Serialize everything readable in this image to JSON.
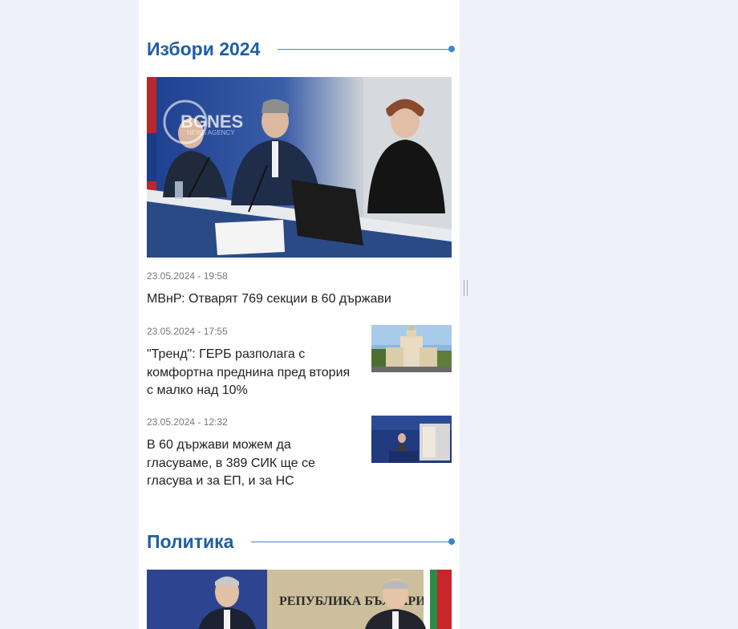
{
  "sections": [
    {
      "title": "Избори 2024",
      "hero_watermark": {
        "brand": "BGNES",
        "sub": "NEWS AGENCY"
      },
      "articles": [
        {
          "date": "23.05.2024 - 19:58",
          "title": "МВнР: Отварят 769 секции в 60 държави"
        },
        {
          "date": "23.05.2024 - 17:55",
          "title": "\"Тренд\": ГЕРБ разполага с комфортна преднина пред втория с малко над 10%"
        },
        {
          "date": "23.05.2024 - 12:32",
          "title": "В 60 държави можем да гласуваме, в 389 СИК ще се гласува и за ЕП, и за НС"
        }
      ]
    },
    {
      "title": "Политика",
      "hero_sign": "РЕПУБЛИКА БЪЛГАРИЯ МИНИСТЕРСКИ СЪВЕТ"
    }
  ],
  "colors": {
    "accent": "#1f5fa3",
    "line": "#3a87c8",
    "page_bg": "#eef1f8"
  }
}
